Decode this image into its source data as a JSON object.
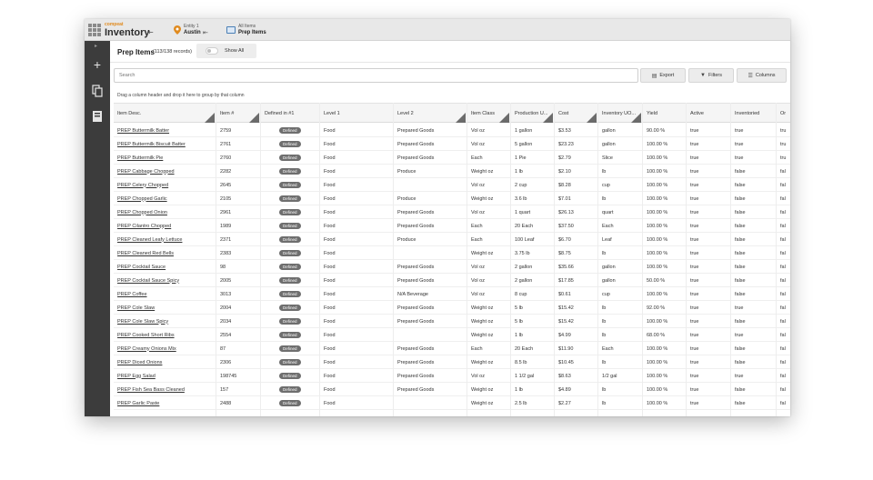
{
  "app": {
    "brand_small": "compeat",
    "title": "Inventory"
  },
  "entity": {
    "label": "Entity 1",
    "name": "Austin"
  },
  "crumb": {
    "label": "All Items",
    "name": "Prep Items"
  },
  "page": {
    "title": "Prep Items",
    "record_count": "(113/138 records)",
    "show_all": "Show All"
  },
  "search": {
    "placeholder": "Search"
  },
  "toolbar": {
    "export": "Export",
    "filters": "Filters",
    "columns": "Columns"
  },
  "group_hint": "Drag a column header and drop it here to group by that column",
  "columns": [
    "Item Desc.",
    "Item #",
    "Defined in #1",
    "Level 1",
    "Level 2",
    "Item Class",
    "Production U...",
    "Cost",
    "Inventory UO...",
    "Yield",
    "Active",
    "Inventoried",
    "Or"
  ],
  "rows": [
    [
      "PREP Buttermilk Batter",
      "2759",
      "Defined",
      "Food",
      "Prepared Goods",
      "Vol oz",
      "1 gallon",
      "$3.53",
      "gallon",
      "90.00 %",
      "true",
      "true",
      "tru"
    ],
    [
      "PREP Buttermilk Biscuit Batter",
      "2761",
      "Defined",
      "Food",
      "Prepared Goods",
      "Vol oz",
      "5 gallon",
      "$23.23",
      "gallon",
      "100.00 %",
      "true",
      "true",
      "tru"
    ],
    [
      "PREP Buttermilk Pie",
      "2760",
      "Defined",
      "Food",
      "Prepared Goods",
      "Each",
      "1 Pie",
      "$2.79",
      "Slice",
      "100.00 %",
      "true",
      "true",
      "tru"
    ],
    [
      "PREP Cabbage Chopped",
      "2282",
      "Defined",
      "Food",
      "Produce",
      "Weight oz",
      "1 lb",
      "$2.10",
      "lb",
      "100.00 %",
      "true",
      "false",
      "fal"
    ],
    [
      "PREP Celery Chopped",
      "2645",
      "Defined",
      "Food",
      "",
      "Vol oz",
      "2 cup",
      "$8.28",
      "cup",
      "100.00 %",
      "true",
      "false",
      "fal"
    ],
    [
      "PREP Chopped Garlic",
      "2105",
      "Defined",
      "Food",
      "Produce",
      "Weight oz",
      "3.6 lb",
      "$7.01",
      "lb",
      "100.00 %",
      "true",
      "false",
      "fal"
    ],
    [
      "PREP Chopped Onion",
      "2961",
      "Defined",
      "Food",
      "Prepared Goods",
      "Vol oz",
      "1 quart",
      "$26.13",
      "quart",
      "100.00 %",
      "true",
      "false",
      "fal"
    ],
    [
      "PREP Cilantro Chopped",
      "1989",
      "Defined",
      "Food",
      "Prepared Goods",
      "Each",
      "20 Each",
      "$37.50",
      "Each",
      "100.00 %",
      "true",
      "false",
      "fal"
    ],
    [
      "PREP Cleaned Leafy Lettuce",
      "2371",
      "Defined",
      "Food",
      "Produce",
      "Each",
      "100 Leaf",
      "$6.70",
      "Leaf",
      "100.00 %",
      "true",
      "false",
      "fal"
    ],
    [
      "PREP Cleaned Red Bells",
      "2383",
      "Defined",
      "Food",
      "",
      "Weight oz",
      "3.75 lb",
      "$8.75",
      "lb",
      "100.00 %",
      "true",
      "false",
      "fal"
    ],
    [
      "PREP Cocktail Sauce",
      "98",
      "Defined",
      "Food",
      "Prepared Goods",
      "Vol oz",
      "2 gallon",
      "$35.66",
      "gallon",
      "100.00 %",
      "true",
      "false",
      "fal"
    ],
    [
      "PREP Cocktail Sauce Spicy",
      "2005",
      "Defined",
      "Food",
      "Prepared Goods",
      "Vol oz",
      "2 gallon",
      "$17.85",
      "gallon",
      "50.00 %",
      "true",
      "false",
      "fal"
    ],
    [
      "PREP Coffee",
      "3013",
      "Defined",
      "Food",
      "N/A Beverage",
      "Vol oz",
      "8 cup",
      "$0.61",
      "cup",
      "100.00 %",
      "true",
      "false",
      "fal"
    ],
    [
      "PREP Cole Slaw",
      "2004",
      "Defined",
      "Food",
      "Prepared Goods",
      "Weight oz",
      "5 lb",
      "$15.42",
      "lb",
      "92.00 %",
      "true",
      "true",
      "fal"
    ],
    [
      "PREP Cole Slaw Spicy",
      "2034",
      "Defined",
      "Food",
      "Prepared Goods",
      "Weight oz",
      "5 lb",
      "$15.42",
      "lb",
      "100.00 %",
      "true",
      "false",
      "fal"
    ],
    [
      "PREP Cooked Short Ribs",
      "2554",
      "Defined",
      "Food",
      "",
      "Weight oz",
      "1 lb",
      "$4.99",
      "lb",
      "68.00 %",
      "true",
      "true",
      "fal"
    ],
    [
      "PREP Creamy Onions Mix",
      "87",
      "Defined",
      "Food",
      "Prepared Goods",
      "Each",
      "20 Each",
      "$11.90",
      "Each",
      "100.00 %",
      "true",
      "false",
      "fal"
    ],
    [
      "PREP Diced Onions",
      "2306",
      "Defined",
      "Food",
      "Prepared Goods",
      "Weight oz",
      "8.5 lb",
      "$10.45",
      "lb",
      "100.00 %",
      "true",
      "false",
      "fal"
    ],
    [
      "PREP Egg Salad",
      "198745",
      "Defined",
      "Food",
      "Prepared Goods",
      "Vol oz",
      "1 1/2 gal",
      "$8.63",
      "1/2 gal",
      "100.00 %",
      "true",
      "true",
      "fal"
    ],
    [
      "PREP Fish Sea Bass Cleaned",
      "157",
      "Defined",
      "Food",
      "Prepared Goods",
      "Weight oz",
      "1 lb",
      "$4.89",
      "lb",
      "100.00 %",
      "true",
      "false",
      "fal"
    ],
    [
      "PREP Garlic Paste",
      "2488",
      "Defined",
      "Food",
      "",
      "Weight oz",
      "2.5 lb",
      "$2.27",
      "lb",
      "100.00 %",
      "true",
      "false",
      "fal"
    ]
  ]
}
